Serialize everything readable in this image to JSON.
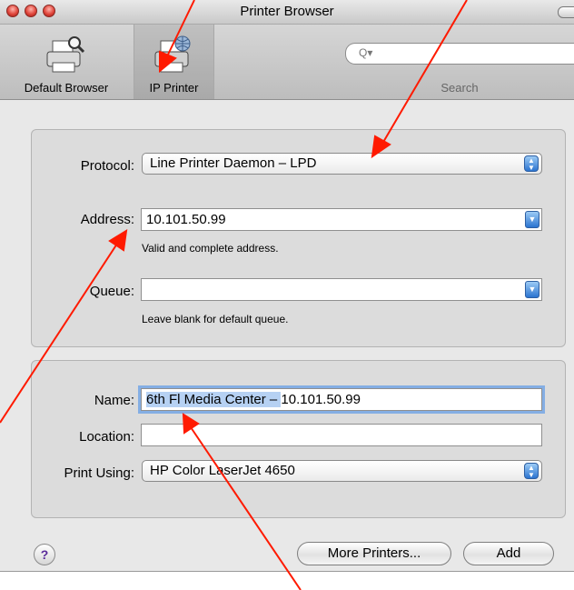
{
  "window": {
    "title": "Printer Browser"
  },
  "toolbar": {
    "default_browser_label": "Default Browser",
    "ip_printer_label": "IP Printer",
    "search_label": "Search",
    "search_value": ""
  },
  "connection": {
    "protocol_label": "Protocol:",
    "protocol_value": "Line Printer Daemon – LPD",
    "address_label": "Address:",
    "address_value": "10.101.50.99",
    "address_hint": "Valid and complete address.",
    "queue_label": "Queue:",
    "queue_value": "",
    "queue_hint": "Leave blank for default queue."
  },
  "details": {
    "name_label": "Name:",
    "name_selected": "6th Fl Media Center – ",
    "name_rest": "10.101.50.99",
    "location_label": "Location:",
    "location_value": "",
    "print_using_label": "Print Using:",
    "print_using_value": "HP Color LaserJet 4650"
  },
  "buttons": {
    "help": "?",
    "more_printers": "More Printers...",
    "add": "Add"
  },
  "colors": {
    "annotation_arrow": "#ff1a00",
    "focus_ring": "#84aee4",
    "selection": "#b6d1f3",
    "popup_arrow": "#2b74d0"
  }
}
